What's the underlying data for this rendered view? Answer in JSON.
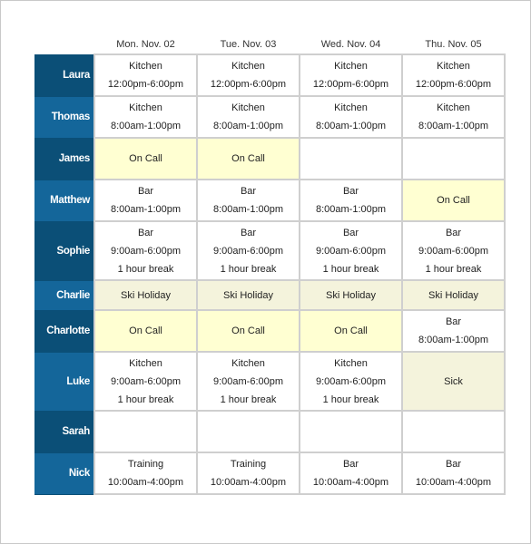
{
  "days": [
    "Mon. Nov. 02",
    "Tue. Nov. 03",
    "Wed. Nov. 04",
    "Thu. Nov. 05"
  ],
  "colors": {
    "name_dark": "#0b4f77",
    "name_light": "#14669a",
    "on_call": "#ffffd2",
    "holiday": "#f4f3dc",
    "grid": "#cfcfcf"
  },
  "rows": [
    {
      "name": "Laura",
      "shade": "dark",
      "height": 2,
      "cells": [
        {
          "type": "shift",
          "lines": [
            "Kitchen",
            "12:00pm-6:00pm"
          ]
        },
        {
          "type": "shift",
          "lines": [
            "Kitchen",
            "12:00pm-6:00pm"
          ]
        },
        {
          "type": "shift",
          "lines": [
            "Kitchen",
            "12:00pm-6:00pm"
          ]
        },
        {
          "type": "shift",
          "lines": [
            "Kitchen",
            "12:00pm-6:00pm"
          ]
        }
      ]
    },
    {
      "name": "Thomas",
      "shade": "light",
      "height": 2,
      "cells": [
        {
          "type": "shift",
          "lines": [
            "Kitchen",
            "8:00am-1:00pm"
          ]
        },
        {
          "type": "shift",
          "lines": [
            "Kitchen",
            "8:00am-1:00pm"
          ]
        },
        {
          "type": "shift",
          "lines": [
            "Kitchen",
            "8:00am-1:00pm"
          ]
        },
        {
          "type": "shift",
          "lines": [
            "Kitchen",
            "8:00am-1:00pm"
          ]
        }
      ]
    },
    {
      "name": "James",
      "shade": "dark",
      "height": 2,
      "cells": [
        {
          "type": "oncall",
          "lines": [
            "On Call"
          ]
        },
        {
          "type": "oncall",
          "lines": [
            "On Call"
          ]
        },
        {
          "type": "empty",
          "lines": []
        },
        {
          "type": "empty",
          "lines": []
        }
      ]
    },
    {
      "name": "Matthew",
      "shade": "light",
      "height": 2,
      "cells": [
        {
          "type": "shift",
          "lines": [
            "Bar",
            "8:00am-1:00pm"
          ]
        },
        {
          "type": "shift",
          "lines": [
            "Bar",
            "8:00am-1:00pm"
          ]
        },
        {
          "type": "shift",
          "lines": [
            "Bar",
            "8:00am-1:00pm"
          ]
        },
        {
          "type": "oncall",
          "lines": [
            "On Call"
          ]
        }
      ]
    },
    {
      "name": "Sophie",
      "shade": "dark",
      "height": 3,
      "cells": [
        {
          "type": "shift",
          "lines": [
            "Bar",
            "9:00am-6:00pm",
            "1 hour break"
          ]
        },
        {
          "type": "shift",
          "lines": [
            "Bar",
            "9:00am-6:00pm",
            "1 hour break"
          ]
        },
        {
          "type": "shift",
          "lines": [
            "Bar",
            "9:00am-6:00pm",
            "1 hour break"
          ]
        },
        {
          "type": "shift",
          "lines": [
            "Bar",
            "9:00am-6:00pm",
            "1 hour break"
          ]
        }
      ]
    },
    {
      "name": "Charlie",
      "shade": "light",
      "height": 1,
      "cells": [
        {
          "type": "holiday",
          "lines": [
            "Ski Holiday"
          ]
        },
        {
          "type": "holiday",
          "lines": [
            "Ski Holiday"
          ]
        },
        {
          "type": "holiday",
          "lines": [
            "Ski Holiday"
          ]
        },
        {
          "type": "holiday",
          "lines": [
            "Ski Holiday"
          ]
        }
      ]
    },
    {
      "name": "Charlotte",
      "shade": "dark",
      "height": 2,
      "cells": [
        {
          "type": "oncall",
          "lines": [
            "On Call"
          ]
        },
        {
          "type": "oncall",
          "lines": [
            "On Call"
          ]
        },
        {
          "type": "oncall",
          "lines": [
            "On Call"
          ]
        },
        {
          "type": "shift",
          "lines": [
            "Bar",
            "8:00am-1:00pm"
          ]
        }
      ]
    },
    {
      "name": "Luke",
      "shade": "light",
      "height": 3,
      "cells": [
        {
          "type": "shift",
          "lines": [
            "Kitchen",
            "9:00am-6:00pm",
            "1 hour break"
          ]
        },
        {
          "type": "shift",
          "lines": [
            "Kitchen",
            "9:00am-6:00pm",
            "1 hour break"
          ]
        },
        {
          "type": "shift",
          "lines": [
            "Kitchen",
            "9:00am-6:00pm",
            "1 hour break"
          ]
        },
        {
          "type": "holiday",
          "lines": [
            "Sick"
          ]
        }
      ]
    },
    {
      "name": "Sarah",
      "shade": "dark",
      "height": 2,
      "cells": [
        {
          "type": "empty",
          "lines": []
        },
        {
          "type": "empty",
          "lines": []
        },
        {
          "type": "empty",
          "lines": []
        },
        {
          "type": "empty",
          "lines": []
        }
      ]
    },
    {
      "name": "Nick",
      "shade": "light",
      "height": 2,
      "cells": [
        {
          "type": "shift",
          "lines": [
            "Training",
            "10:00am-4:00pm"
          ]
        },
        {
          "type": "shift",
          "lines": [
            "Training",
            "10:00am-4:00pm"
          ]
        },
        {
          "type": "shift",
          "lines": [
            "Bar",
            "10:00am-4:00pm"
          ]
        },
        {
          "type": "shift",
          "lines": [
            "Bar",
            "10:00am-4:00pm"
          ]
        }
      ]
    }
  ]
}
